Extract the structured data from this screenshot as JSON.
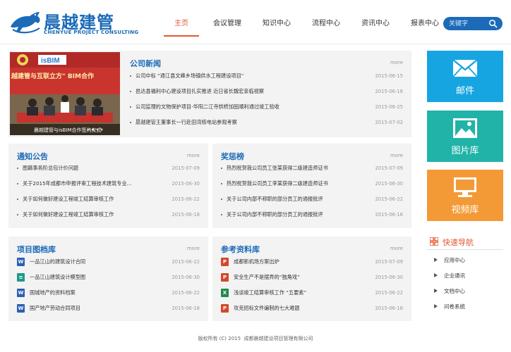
{
  "brand": {
    "name_cn": "晨越建管",
    "name_en": "CHENYUE PROJECT CONSULTING",
    "color": "#1c6bb8",
    "accent": "#e4572e"
  },
  "nav": {
    "items": [
      {
        "label": "主页",
        "active": true
      },
      {
        "label": "会议管理"
      },
      {
        "label": "知识中心"
      },
      {
        "label": "流程中心"
      },
      {
        "label": "资讯中心"
      },
      {
        "label": "报表中心"
      }
    ]
  },
  "search": {
    "placeholder": "关键字",
    "icon": "search-icon"
  },
  "news": {
    "title": "公司新闻",
    "more": "more",
    "photo": {
      "banner_logo": "isBIM",
      "banner_text": "越建管与互联立方\" BIM合作",
      "caption": "晨越建管与isBIM合作签约仪式"
    },
    "items": [
      {
        "text": "公司中标 “通江县文峰乡场镇供水工程建设项目”",
        "date": "2015-06-15"
      },
      {
        "text": "邑达县福利中心建设项目扎实推进 近日省长魏宏亲临视察",
        "date": "2015-06-18"
      },
      {
        "text": "公司监理的文物保护项目-华阳二江寺拱桥加固顺利通过竣工验收",
        "date": "2015-06-25"
      },
      {
        "text": "晨越建管王董事长一行赴田湾核电站参观考察",
        "date": "2015-07-02"
      }
    ]
  },
  "notice": {
    "title": "通知公告",
    "more": "more",
    "items": [
      {
        "text": "图籍事务阶总包计价问题",
        "date": "2015-07-09"
      },
      {
        "text": "关于2015年成都市申报评审工程技术建筑专业...",
        "date": "2015-06-30"
      },
      {
        "text": "关于如何做好建设工程竣工结算审核工作",
        "date": "2015-06-22"
      },
      {
        "text": "关于如何做好建设工程竣工结算审核工作",
        "date": "2015-06-18"
      }
    ]
  },
  "awards": {
    "title": "奖惩榜",
    "more": "more",
    "items": [
      {
        "text": "热烈祝贺我公司员工张某获得二级建造师证书",
        "date": "2015-07-09"
      },
      {
        "text": "热烈祝贺我公司员工李某获得二级建造师证书",
        "date": "2015-06-30"
      },
      {
        "text": "关于公司内部不称职的部分员工的通报批评",
        "date": "2015-06-22"
      },
      {
        "text": "关于公司内部不称职的部分员工的通报批评",
        "date": "2015-06-16"
      }
    ]
  },
  "archive": {
    "title": "项目图档库",
    "more": "more",
    "items": [
      {
        "text": "一品江山的建筑设计合同",
        "date": "2015-06-22",
        "icon": "word-file-icon"
      },
      {
        "text": "一品江山建筑设计模型图",
        "date": "2015-06-30",
        "icon": "model-file-icon"
      },
      {
        "text": "国城地产的资料档案",
        "date": "2015-06-22",
        "icon": "word-file-icon"
      },
      {
        "text": "国产地产劳动合同项目",
        "date": "2015-06-18",
        "icon": "word-file-icon"
      }
    ]
  },
  "reference": {
    "title": "参考资料库",
    "more": "more",
    "items": [
      {
        "text": "成都新机场方案出炉",
        "date": "2015-07-09",
        "icon": "ppt-file-icon"
      },
      {
        "text": "安全生产不是摆弄的“独角戏”",
        "date": "2015-06-30",
        "icon": "ppt-file-icon"
      },
      {
        "text": "浅谈竣工结算审核工作 “五要素”",
        "date": "2015-06-22",
        "icon": "excel-file-icon"
      },
      {
        "text": "攻克招标文件编制的七大难题",
        "date": "2015-06-16",
        "icon": "ppt-file-icon"
      }
    ]
  },
  "tiles": {
    "mail": {
      "label": "邮件",
      "color": "#16a5e0",
      "icon": "mail-icon"
    },
    "photo": {
      "label": "图片库",
      "color": "#21b3a7",
      "icon": "image-icon"
    },
    "video": {
      "label": "视频库",
      "color": "#f39a36",
      "icon": "monitor-icon"
    }
  },
  "quick_nav": {
    "title": "快速导航",
    "items": [
      {
        "label": "应用中心"
      },
      {
        "label": "企业通讯"
      },
      {
        "label": "文档中心"
      },
      {
        "label": "问卷系统"
      }
    ]
  },
  "footer": {
    "text": "版权所有 (C) 2015  成都晨越建设项目管理有限公司"
  }
}
